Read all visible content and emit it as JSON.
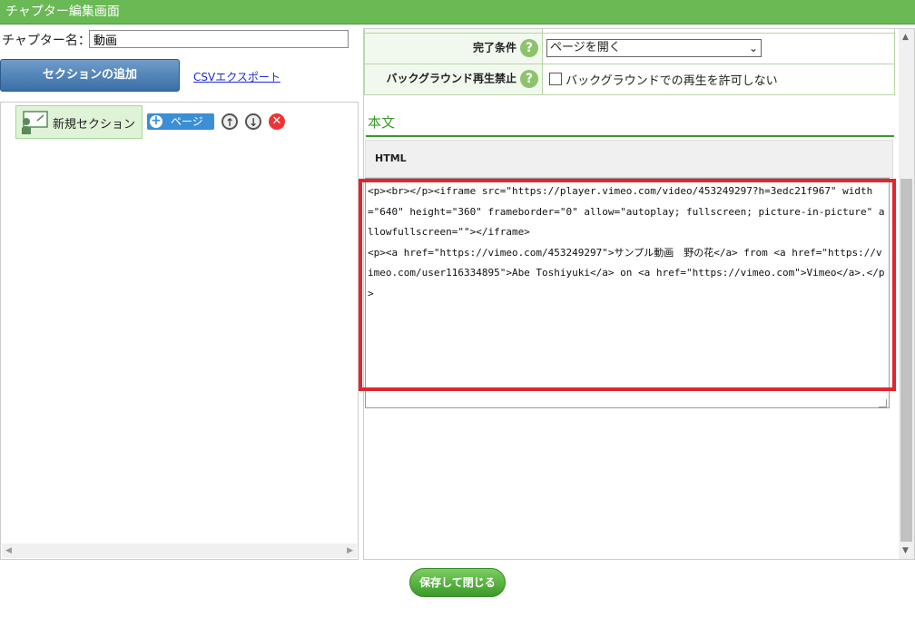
{
  "window": {
    "title": "チャプター編集画面"
  },
  "chapter": {
    "name_label": "チャプター名：",
    "name_value": "動画"
  },
  "toolbar": {
    "add_section_label": "セクションの追加",
    "csv_export_label": "CSVエクスポート"
  },
  "tree": {
    "section_label": "新規セクション",
    "page_button_label": "ページ"
  },
  "settings": {
    "completion_label": "完了条件",
    "completion_value": "ページを開く",
    "background_label": "バックグラウンド再生禁止",
    "background_checkbox_label": "バックグラウンドでの再生を許可しない",
    "background_checked": false
  },
  "body_section": {
    "title": "本文",
    "html_tab": "HTML",
    "html_content": "<p><br></p><iframe src=\"https://player.vimeo.com/video/453249297?h=3edc21f967\" width=\"640\" height=\"360\" frameborder=\"0\" allow=\"autoplay; fullscreen; picture-in-picture\" allowfullscreen=\"\"></iframe>\n<p><a href=\"https://vimeo.com/453249297\">サンプル動画　野の花</a> from <a href=\"https://vimeo.com/user116334895\">Abe Toshiyuki</a> on <a href=\"https://vimeo.com\">Vimeo</a>.</p>"
  },
  "footer": {
    "save_close_label": "保存して閉じる"
  },
  "colors": {
    "header_green": "#69b954",
    "accent_blue": "#3a8fd6",
    "highlight_red": "#e0262d"
  }
}
